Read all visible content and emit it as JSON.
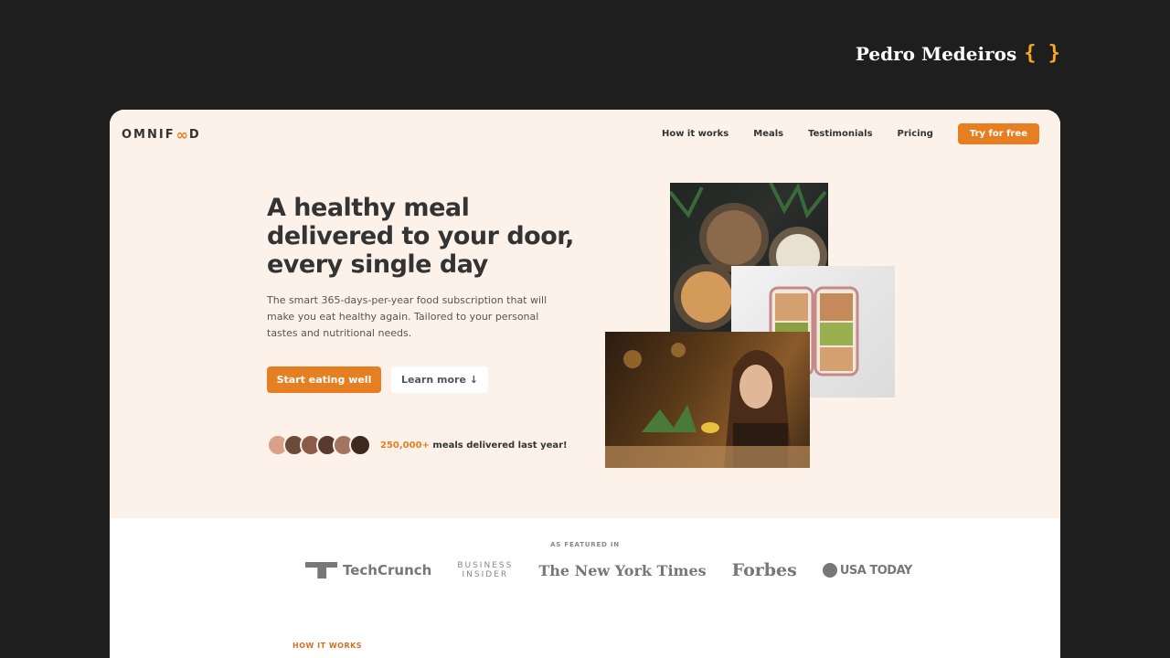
{
  "author": {
    "name": "Pedro Medeiros",
    "braces": "{ }"
  },
  "header": {
    "logo_before": "OMNIF",
    "logo_mark": "∞",
    "logo_after": "D",
    "nav": [
      {
        "label": "How it works"
      },
      {
        "label": "Meals"
      },
      {
        "label": "Testimonials"
      },
      {
        "label": "Pricing"
      }
    ],
    "cta": "Try for free"
  },
  "hero": {
    "title": "A healthy meal delivered to your door, every single day",
    "description": "The smart 365-days-per-year food subscription that will make you eat healthy again. Tailored to your personal tastes and nutritional needs.",
    "primary_button": "Start eating well",
    "secondary_button": "Learn more ↓",
    "delivered_count": "250,000+",
    "delivered_text": " meals delivered last year!",
    "avatars": [
      "#d9a08a",
      "#6b4a3a",
      "#8a5c48",
      "#5a3a2e",
      "#a37560",
      "#3e2a20"
    ]
  },
  "press": {
    "label": "AS FEATURED IN",
    "logos": {
      "techcrunch": "TechCrunch",
      "business_insider_1": "BUSINESS",
      "business_insider_2": "INSIDER",
      "nyt": "The New York Times",
      "forbes": "Forbes",
      "usatoday": "USA TODAY"
    }
  },
  "how_it_works": {
    "label": "HOW IT WORKS"
  },
  "colors": {
    "accent": "#e67e22",
    "hero_bg": "#fdf2e9",
    "page_bg": "#1e1e1e"
  }
}
